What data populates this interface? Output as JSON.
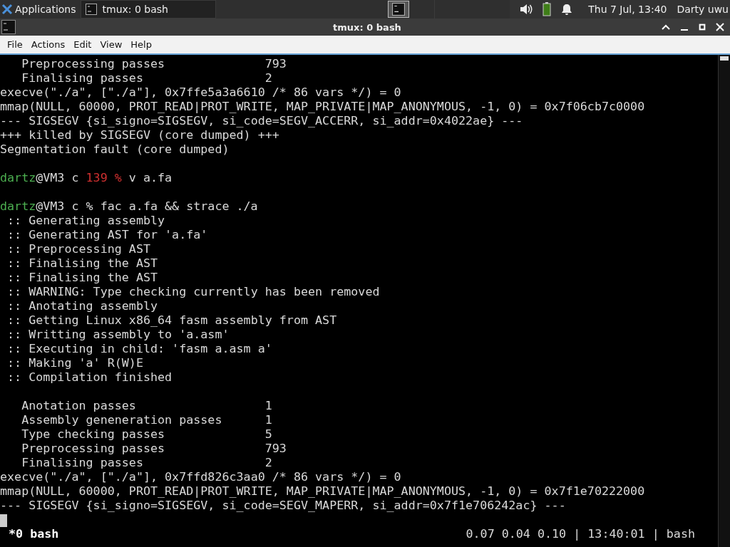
{
  "panel": {
    "applications": "Applications",
    "task": "tmux: 0 bash",
    "clock": "Thu  7 Jul, 13:40",
    "user": "Darty uwu"
  },
  "window": {
    "title": "tmux: 0 bash"
  },
  "menu": [
    "File",
    "Actions",
    "Edit",
    "View",
    "Help"
  ],
  "terminal": {
    "lines": [
      {
        "kind": "text",
        "text": "   Preprocessing passes              793"
      },
      {
        "kind": "text",
        "text": "   Finalising passes                 2"
      },
      {
        "kind": "text",
        "text": "execve(\"./a\", [\"./a\"], 0x7ffe5a3a6610 /* 86 vars */) = 0"
      },
      {
        "kind": "text",
        "text": "mmap(NULL, 60000, PROT_READ|PROT_WRITE, MAP_PRIVATE|MAP_ANONYMOUS, -1, 0) = 0x7f06cb7c0000"
      },
      {
        "kind": "text",
        "text": "--- SIGSEGV {si_signo=SIGSEGV, si_code=SEGV_ACCERR, si_addr=0x4022ae} ---"
      },
      {
        "kind": "text",
        "text": "+++ killed by SIGSEGV (core dumped) +++"
      },
      {
        "kind": "text",
        "text": "Segmentation fault (core dumped)"
      },
      {
        "kind": "blank"
      },
      {
        "kind": "prompt",
        "user": "dartz",
        "host": "@VM3 c",
        "status": "139 %",
        "command": "v a.fa"
      },
      {
        "kind": "blank"
      },
      {
        "kind": "prompt",
        "user": "dartz",
        "host": "@VM3 c",
        "command": "% fac a.fa && strace ./a"
      },
      {
        "kind": "text",
        "text": " :: Generating assembly"
      },
      {
        "kind": "text",
        "text": " :: Generating AST for 'a.fa'"
      },
      {
        "kind": "text",
        "text": " :: Preprocessing AST"
      },
      {
        "kind": "text",
        "text": " :: Finalising the AST"
      },
      {
        "kind": "text",
        "text": " :: Finalising the AST"
      },
      {
        "kind": "text",
        "text": " :: WARNING: Type checking currently has been removed"
      },
      {
        "kind": "text",
        "text": " :: Anotating assembly"
      },
      {
        "kind": "text",
        "text": " :: Getting Linux x86_64 fasm assembly from AST"
      },
      {
        "kind": "text",
        "text": " :: Writting assembly to 'a.asm'"
      },
      {
        "kind": "text",
        "text": " :: Executing in child: 'fasm a.asm a'"
      },
      {
        "kind": "text",
        "text": " :: Making 'a' R(W)E"
      },
      {
        "kind": "text",
        "text": " :: Compilation finished"
      },
      {
        "kind": "blank"
      },
      {
        "kind": "text",
        "text": "   Anotation passes                  1"
      },
      {
        "kind": "text",
        "text": "   Assembly geneneration passes      1"
      },
      {
        "kind": "text",
        "text": "   Type checking passes              5"
      },
      {
        "kind": "text",
        "text": "   Preprocessing passes              793"
      },
      {
        "kind": "text",
        "text": "   Finalising passes                 2"
      },
      {
        "kind": "text",
        "text": "execve(\"./a\", [\"./a\"], 0x7ffd826c3aa0 /* 86 vars */) = 0"
      },
      {
        "kind": "text",
        "text": "mmap(NULL, 60000, PROT_READ|PROT_WRITE, MAP_PRIVATE|MAP_ANONYMOUS, -1, 0) = 0x7f1e70222000"
      },
      {
        "kind": "text",
        "text": "--- SIGSEGV {si_signo=SIGSEGV, si_code=SEGV_MAPERR, si_addr=0x7f1e706242ac} ---"
      },
      {
        "kind": "cursor"
      }
    ]
  },
  "tmux_status": {
    "window": "*0 bash",
    "right": "0.07 0.04 0.10 | 13:40:01 | bash"
  }
}
